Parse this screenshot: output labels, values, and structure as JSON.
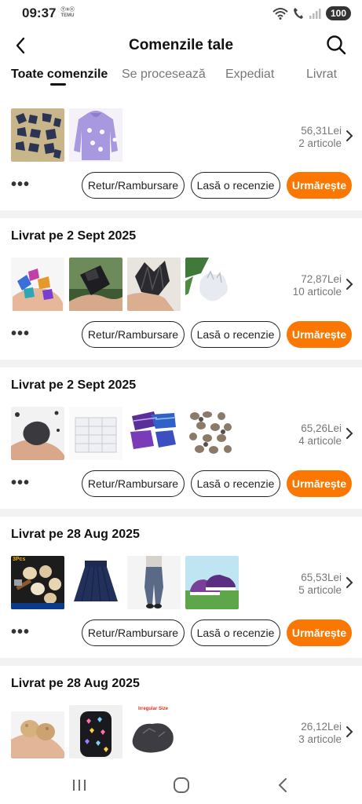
{
  "status_bar": {
    "time": "09:37",
    "app_badge_line1": "Ⓣ⑨ⓔ",
    "app_badge_line2": "TEMU",
    "battery": "100"
  },
  "header": {
    "title": "Comenzile tale"
  },
  "tabs": [
    {
      "label": "Toate comenzile",
      "active": true
    },
    {
      "label": "Se procesează",
      "active": false
    },
    {
      "label": "Expediat",
      "active": false
    },
    {
      "label": "Livrat",
      "active": false
    }
  ],
  "buttons": {
    "return": "Retur/Rambursare",
    "review": "Lasă o recenzie",
    "track": "Urmărește",
    "more": "•••"
  },
  "orders": [
    {
      "title": "",
      "price": "56,31Lei",
      "items": "2 articole",
      "thumbnails": [
        "dark-crystals-on-tray",
        "purple-hoodie"
      ]
    },
    {
      "title": "Livrat pe 2 Sept 2025",
      "price": "72,87Lei",
      "items": "10 articole",
      "thumbnails": [
        "iridescent-stones-in-hand",
        "black-tourmaline",
        "black-crystal-cluster",
        "white-quartz-cluster"
      ]
    },
    {
      "title": "Livrat pe 2 Sept 2025",
      "price": "65,26Lei",
      "items": "4 articole",
      "thumbnails": [
        "black-rock-in-hand",
        "plastic-storage-drawers",
        "purple-blue-stones",
        "tumbled-stones-pile"
      ]
    },
    {
      "title": "Livrat pe 28 Aug 2025",
      "price": "65,53Lei",
      "items": "5 articole",
      "thumbnails": [
        "geode-set-with-hammer",
        "navy-pleated-skirt",
        "gray-leggings",
        "purple-sneakers"
      ]
    },
    {
      "title": "Livrat pe 28 Aug 2025",
      "price": "26,12Lei",
      "items": "3 articole",
      "thumbnails": [
        "geodes-in-hand",
        "heart-pattern-backpack",
        "black-rough-stone"
      ]
    }
  ],
  "thumbnail_text": {
    "geode_set": "3Pcs",
    "irregular_size": "Irregular Size"
  },
  "navigation": {
    "recents": "recents-icon",
    "home": "home-icon",
    "back": "back-icon"
  }
}
